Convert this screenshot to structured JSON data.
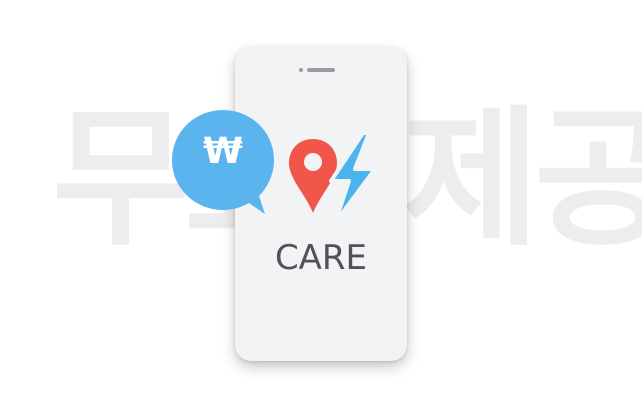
{
  "background": {
    "left_text": "무료",
    "right_text": "제공",
    "color": "#ededee"
  },
  "phone": {
    "screen_color": "#f2f3f5",
    "brand_label": "CARE",
    "logo": {
      "pin_icon": "location-pin-icon",
      "bolt_icon": "lightning-bolt-icon",
      "pin_color": "#f0564a",
      "bolt_color": "#4ab4ec"
    }
  },
  "bubble": {
    "symbol": "₩",
    "icon": "speech-bubble-icon",
    "color": "#5cb4ee"
  }
}
